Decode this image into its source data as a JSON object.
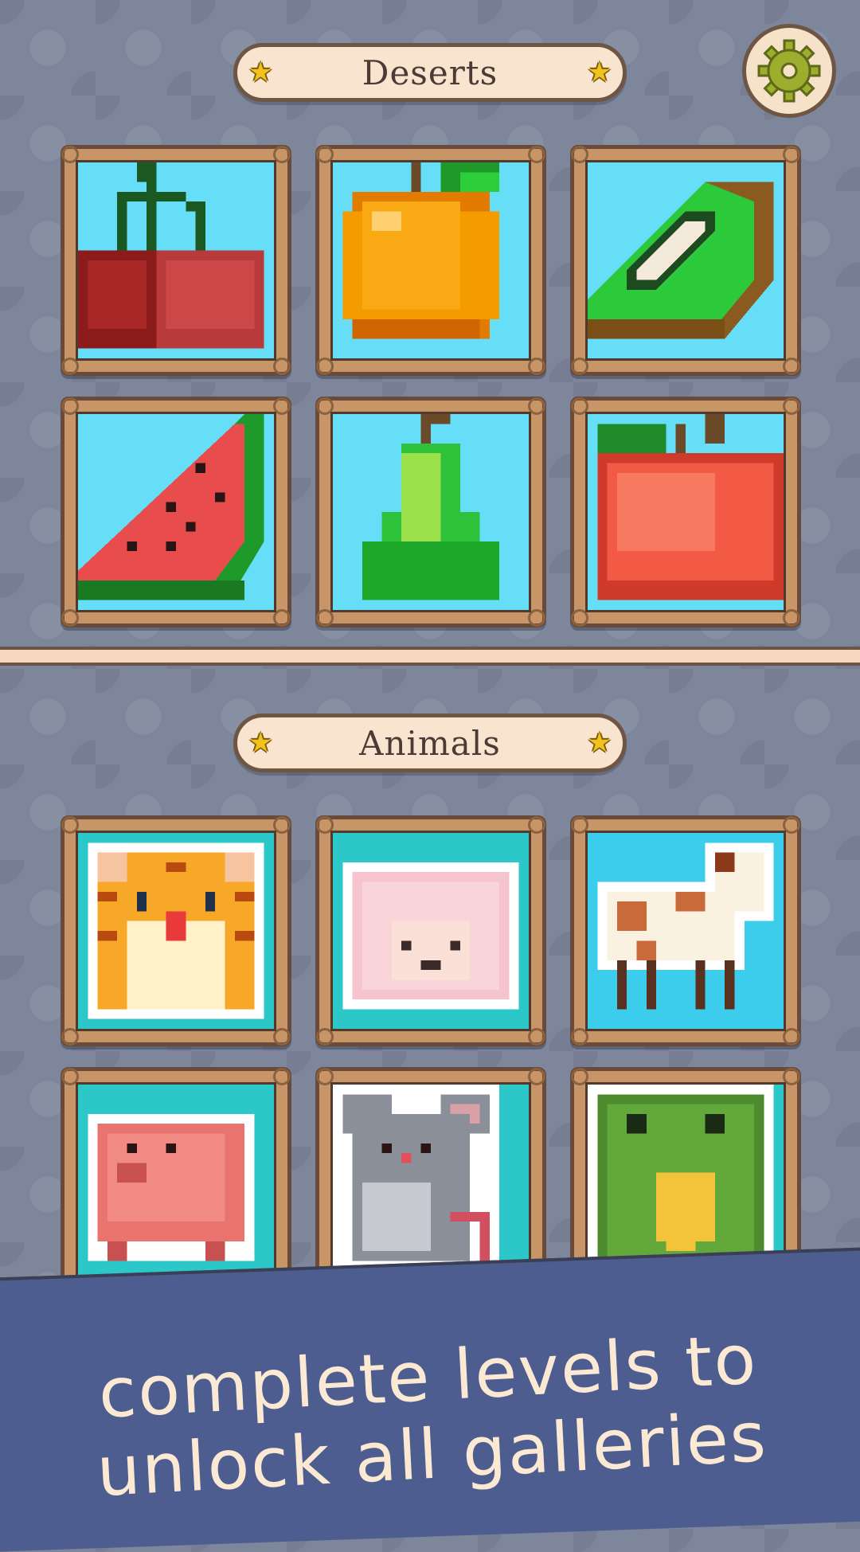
{
  "sections": [
    {
      "title": "Deserts",
      "tiles": [
        {
          "name": "cherries"
        },
        {
          "name": "orange"
        },
        {
          "name": "kiwi"
        },
        {
          "name": "watermelon"
        },
        {
          "name": "pear"
        },
        {
          "name": "apple"
        }
      ]
    },
    {
      "title": "Animals",
      "tiles": [
        {
          "name": "tiger"
        },
        {
          "name": "sheep"
        },
        {
          "name": "cow"
        },
        {
          "name": "pig"
        },
        {
          "name": "mouse"
        },
        {
          "name": "frog"
        }
      ]
    }
  ],
  "settings_icon": "gear-icon",
  "footer": {
    "line1": "complete levels to",
    "line2": "unlock all galleries"
  },
  "colors": {
    "background": "#7e869c",
    "banner": "#f8e4cf",
    "frame": "#c89566",
    "footer": "#4d5d8f",
    "star": "#f0c21a"
  }
}
